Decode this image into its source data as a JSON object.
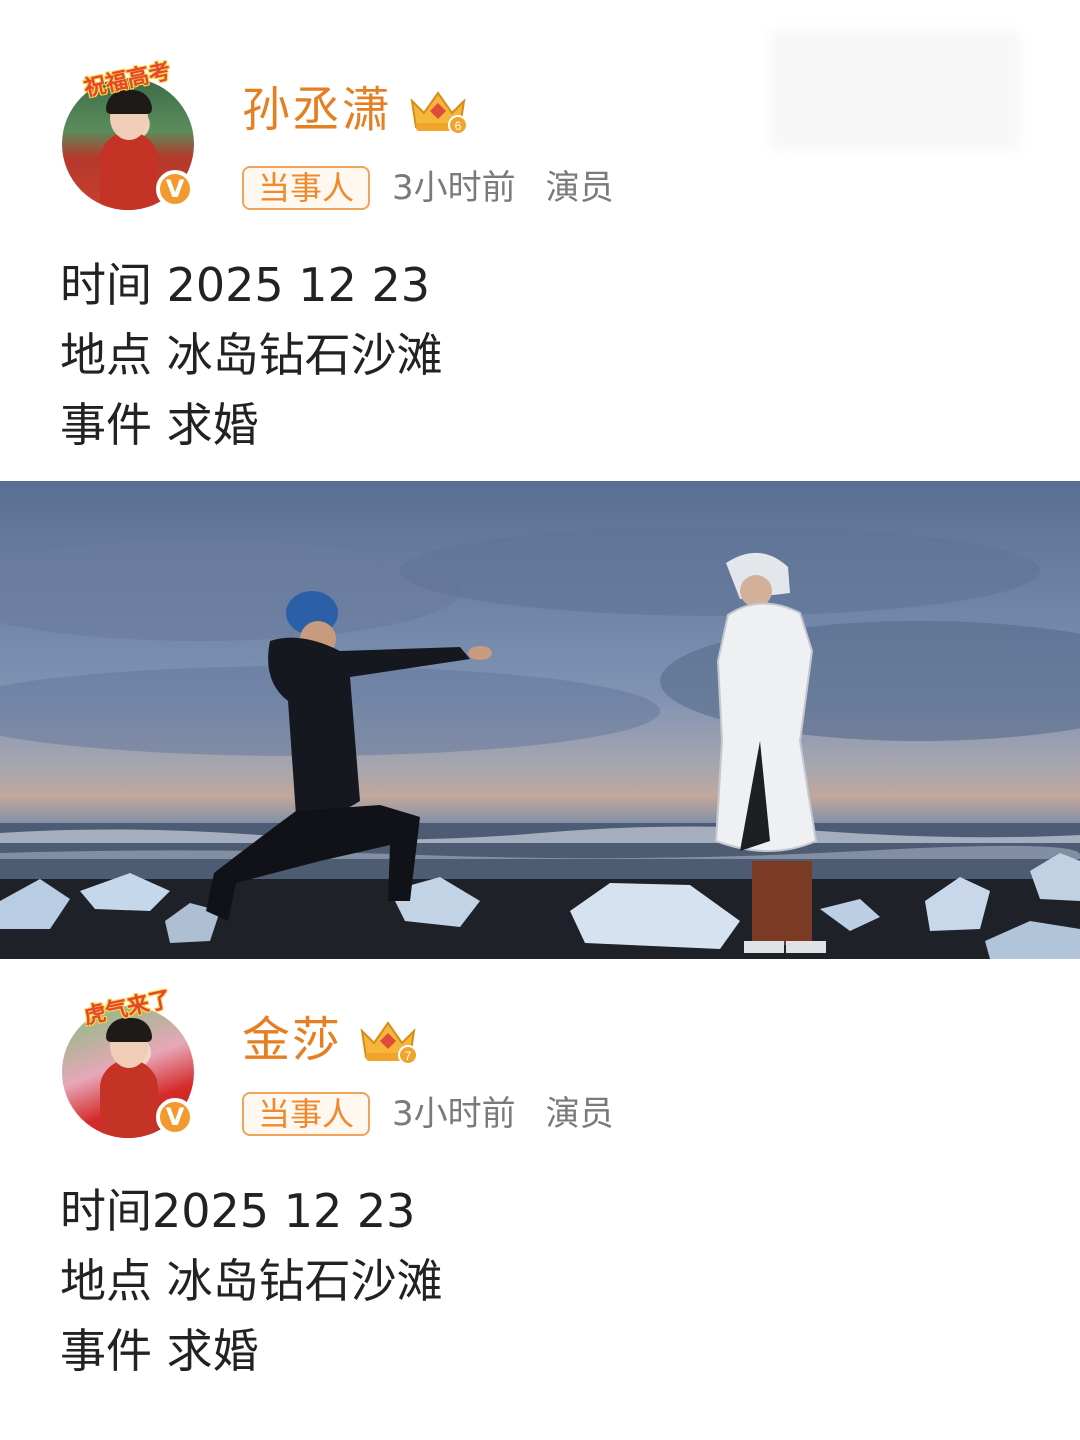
{
  "posts": [
    {
      "avatar_frame_text": "祝福高考",
      "user_name": "孙丞潇",
      "level_badge": "6",
      "tag": "当事人",
      "time_ago": "3小时前",
      "role": "演员",
      "lines": [
        "时间 2025 12 23",
        "地点 冰岛钻石沙滩",
        "事件 求婚"
      ]
    },
    {
      "avatar_frame_text": "虎气来了",
      "user_name": "金莎",
      "level_badge": "7",
      "tag": "当事人",
      "time_ago": "3小时前",
      "role": "演员",
      "lines": [
        "时间2025 12 23",
        "地点 冰岛钻石沙滩",
        "事件 求婚"
      ]
    }
  ],
  "verify_mark": "V",
  "colors": {
    "name": "#e67e22",
    "tag": "#ee8a2e",
    "meta": "#7a7a7a",
    "text": "#222222"
  },
  "icons": [
    "verified-badge-icon",
    "crown-level-icon"
  ]
}
